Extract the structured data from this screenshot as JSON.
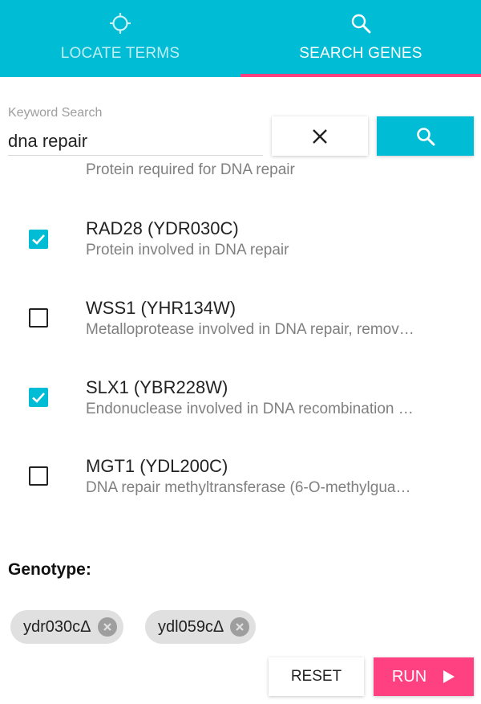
{
  "tabs": [
    {
      "label": "LOCATE TERMS",
      "icon": "crosshair-icon",
      "active": false
    },
    {
      "label": "SEARCH GENES",
      "icon": "search-icon",
      "active": true
    }
  ],
  "search": {
    "label": "Keyword Search",
    "value": "dna repair"
  },
  "results": [
    {
      "name": "",
      "description": "Protein required for DNA repair",
      "checked": true
    },
    {
      "name": "RAD28 (YDR030C)",
      "description": "Protein involved in DNA repair",
      "checked": true
    },
    {
      "name": "WSS1 (YHR134W)",
      "description": "Metalloprotease involved in DNA repair, remov…",
      "checked": false
    },
    {
      "name": "SLX1 (YBR228W)",
      "description": "Endonuclease involved in DNA recombination …",
      "checked": true
    },
    {
      "name": "MGT1 (YDL200C)",
      "description": "DNA repair methyltransferase (6-O-methylgua…",
      "checked": false
    }
  ],
  "genotype": {
    "label": "Genotype:",
    "chips": [
      "ydr030cΔ",
      "ydl059cΔ"
    ]
  },
  "actions": {
    "reset_label": "RESET",
    "run_label": "RUN"
  },
  "colors": {
    "primary": "#00bcd4",
    "accent": "#ff4081"
  }
}
